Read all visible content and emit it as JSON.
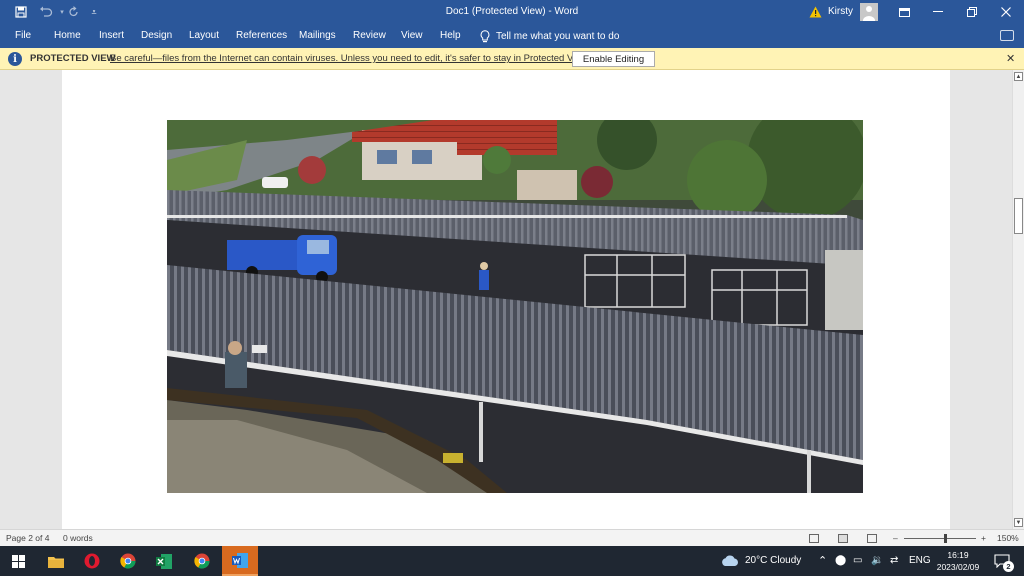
{
  "window": {
    "title": "Doc1  (Protected View)  -  Word",
    "user": "Kirsty"
  },
  "menu": [
    "File",
    "Home",
    "Insert",
    "Design",
    "Layout",
    "References",
    "Mailings",
    "Review",
    "View",
    "Help"
  ],
  "tell_me": "Tell me what you want to do",
  "protected_view": {
    "label": "PROTECTED VIEW",
    "message": "Be careful—files from the Internet can contain viruses. Unless you need to edit, it's safer to stay in Protected View.",
    "button": "Enable Editing"
  },
  "status": {
    "page": "Page 2 of 4",
    "words": "0 words",
    "zoom": "150%"
  },
  "taskbar": {
    "weather": "20°C  Cloudy",
    "language": "ENG",
    "time": "16:19",
    "date": "2023/02/09",
    "notifications": "2"
  },
  "icons": {
    "save": "save-icon",
    "undo": "undo-icon",
    "redo": "redo-icon",
    "warning": "warning-icon",
    "ribbon_display": "ribbon-display-icon",
    "lightbulb": "lightbulb-icon",
    "shield": "info-shield-icon"
  },
  "colors": {
    "title_bar": "#2b579a",
    "protected_bar": "#fff3b5",
    "taskbar": "#1f2732"
  }
}
